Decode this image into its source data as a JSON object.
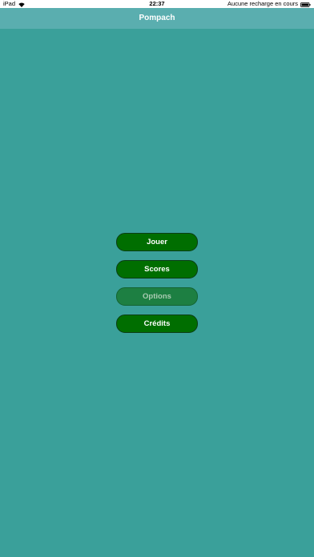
{
  "status_bar": {
    "device": "iPad",
    "time": "22:37",
    "charge_status": "Aucune recharge en cours"
  },
  "nav": {
    "title": "Pompach"
  },
  "menu": {
    "play_label": "Jouer",
    "scores_label": "Scores",
    "options_label": "Options",
    "credits_label": "Crédits"
  },
  "colors": {
    "background": "#3aa09a",
    "nav_bar": "#5aaeaf",
    "button": "#006e00",
    "button_disabled": "#1d7f42"
  }
}
